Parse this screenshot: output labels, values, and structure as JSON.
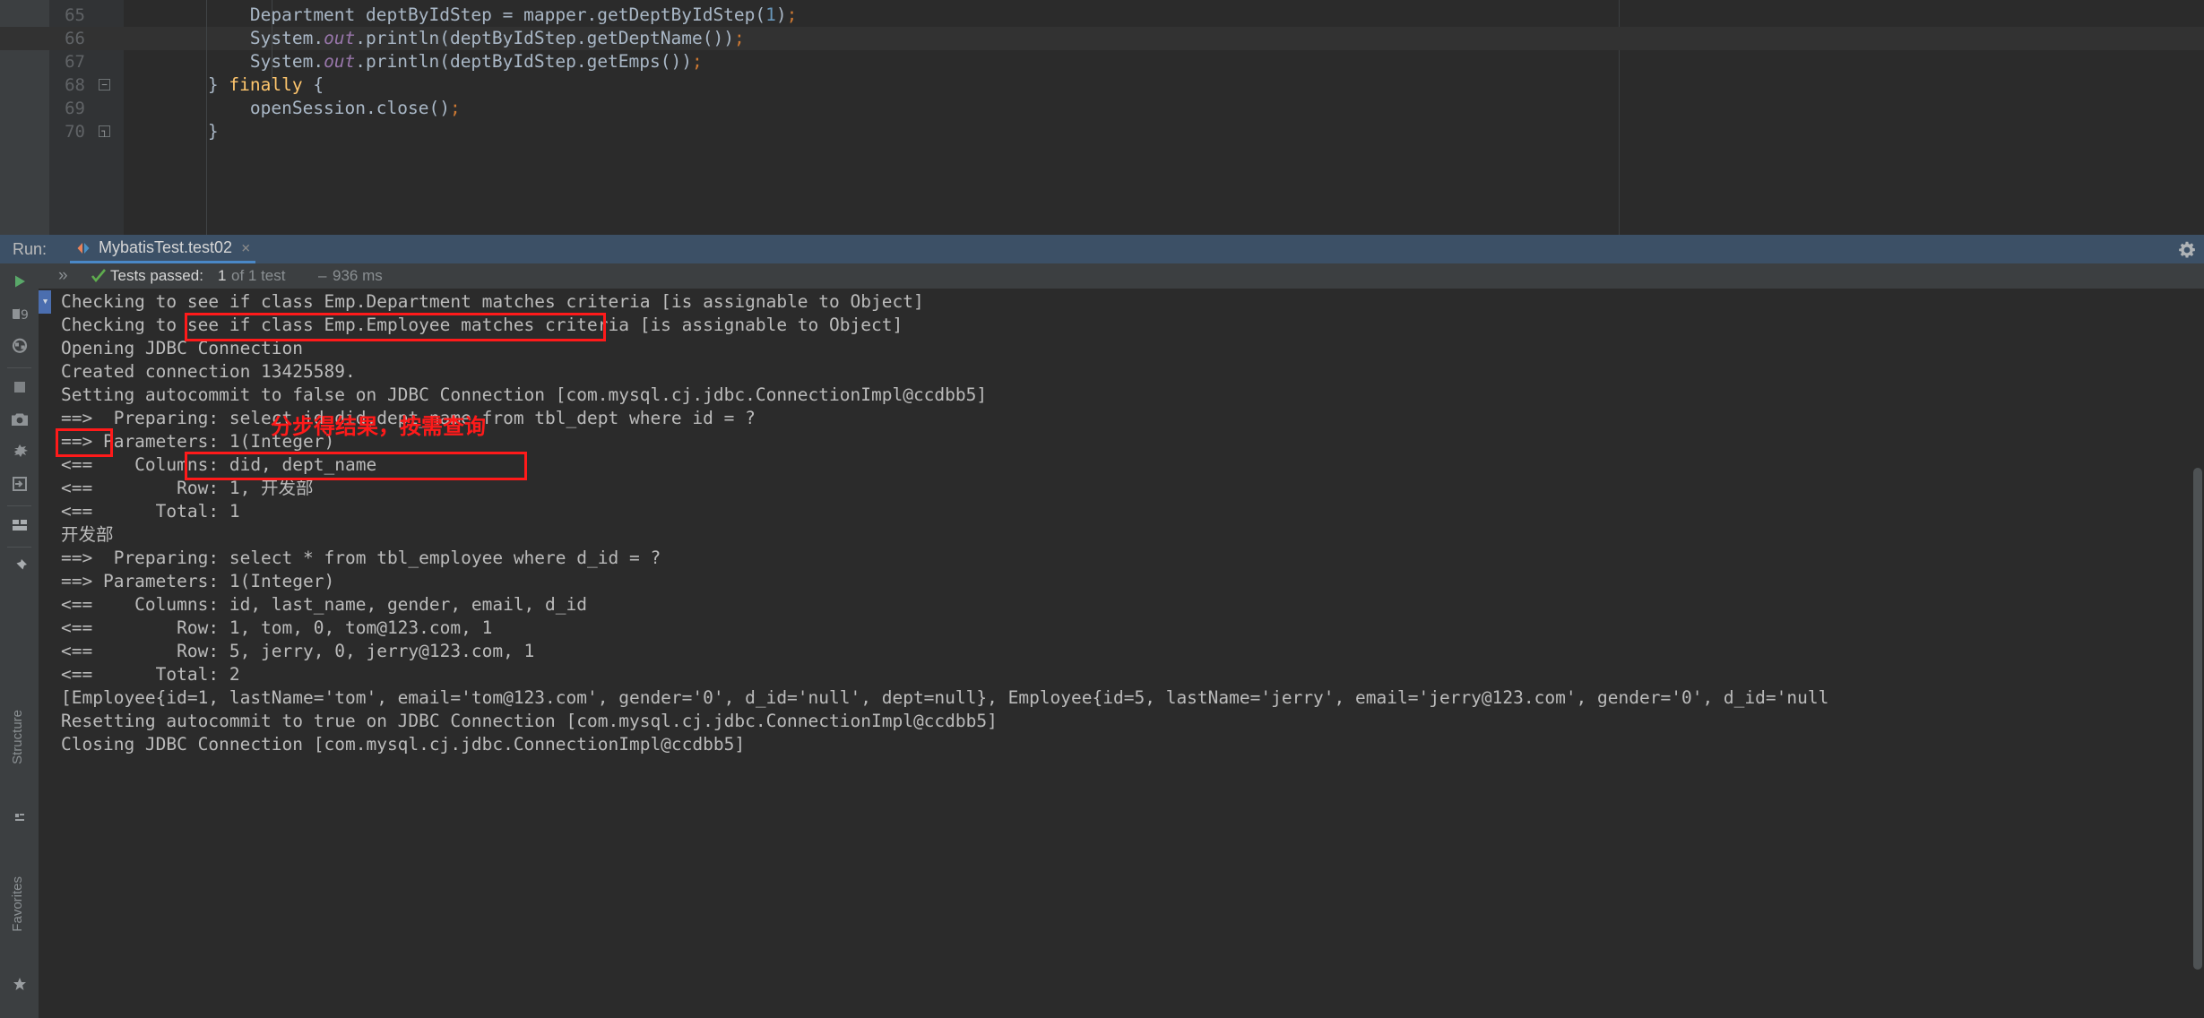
{
  "editor": {
    "lines": [
      {
        "no": "65",
        "indent": 0,
        "segments": [
          {
            "t": "            Department deptByIdStep = mapper.getDeptByIdStep(",
            "c": "plain"
          },
          {
            "t": "1",
            "c": "num"
          },
          {
            "t": ")",
            "c": "plain"
          },
          {
            "t": ";",
            "c": "semi"
          }
        ]
      },
      {
        "no": "66",
        "highlight": true,
        "segments": [
          {
            "t": "            System.",
            "c": "plain"
          },
          {
            "t": "out",
            "c": "static"
          },
          {
            "t": ".println(deptByIdStep.getDeptName())",
            "c": "plain"
          },
          {
            "t": ";",
            "c": "semi"
          }
        ]
      },
      {
        "no": "67",
        "segments": [
          {
            "t": "            System.",
            "c": "plain"
          },
          {
            "t": "out",
            "c": "static"
          },
          {
            "t": ".println(deptByIdStep.getEmps())",
            "c": "plain"
          },
          {
            "t": ";",
            "c": "semi"
          }
        ]
      },
      {
        "no": "68",
        "fold": "minus",
        "segments": [
          {
            "t": "        } ",
            "c": "plain"
          },
          {
            "t": "finally",
            "c": "kw-y"
          },
          {
            "t": " {",
            "c": "plain"
          }
        ]
      },
      {
        "no": "69",
        "segments": [
          {
            "t": "            openSession.close()",
            "c": "plain"
          },
          {
            "t": ";",
            "c": "semi"
          }
        ]
      },
      {
        "no": "70",
        "fold": "end",
        "segments": [
          {
            "t": "        }",
            "c": "plain"
          }
        ]
      }
    ]
  },
  "run_panel": {
    "label": "Run:",
    "tab_name": "MybatisTest.test02",
    "tab_close": "×",
    "settings_icon": "gear-icon",
    "status": {
      "passed_label": "Tests passed:",
      "passed_count": "1",
      "of_text": "of 1 test",
      "separator": "–",
      "duration": "936 ms"
    },
    "toolbar_icons": [
      "rerun-play-icon",
      "rerun-failed-icon",
      "rerun-auto-icon",
      "stop-icon",
      "export-camera-icon",
      "filter-bug-icon",
      "import-icon",
      "layout-icon",
      "pin-icon"
    ]
  },
  "tool_windows": {
    "structure_label": "Structure",
    "favorites_label": "Favorites"
  },
  "console": {
    "lines": [
      "Checking to see if class Emp.Department matches criteria [is assignable to Object]",
      "Checking to see if class Emp.Employee matches criteria [is assignable to Object]",
      "Opening JDBC Connection",
      "Created connection 13425589.",
      "Setting autocommit to false on JDBC Connection [com.mysql.cj.jdbc.ConnectionImpl@ccdbb5]",
      "==>  Preparing: select id did,dept_name from tbl_dept where id = ?",
      "==> Parameters: 1(Integer)",
      "<==    Columns: did, dept_name",
      "<==        Row: 1, 开发部",
      "<==      Total: 1",
      "开发部",
      "==>  Preparing: select * from tbl_employee where d_id = ?",
      "==> Parameters: 1(Integer)",
      "<==    Columns: id, last_name, gender, email, d_id",
      "<==        Row: 1, tom, 0, tom@123.com, 1",
      "<==        Row: 5, jerry, 0, jerry@123.com, 1",
      "<==      Total: 2",
      "[Employee{id=1, lastName='tom', email='tom@123.com', gender='0', d_id='null', dept=null}, Employee{id=5, lastName='jerry', email='jerry@123.com', gender='0', d_id='null",
      "Resetting autocommit to true on JDBC Connection [com.mysql.cj.jdbc.ConnectionImpl@ccdbb5]",
      "Closing JDBC Connection [com.mysql.cj.jdbc.ConnectionImpl@ccdbb5]"
    ]
  },
  "annotations": {
    "note_text": "分步得结果，按需查询",
    "box_labels": [
      "select id did,dept_name from tbl_dept where id = ?",
      "开发部",
      "select * from tbl_employee where d_id = ?"
    ]
  },
  "colors": {
    "annotation_red": "#ff1a1a",
    "accent_blue": "#4a88c7",
    "pass_green": "#5fad4e",
    "editor_bg": "#2b2b2b",
    "panel_bg": "#3c3f41",
    "run_header_bg": "#3c5066"
  }
}
